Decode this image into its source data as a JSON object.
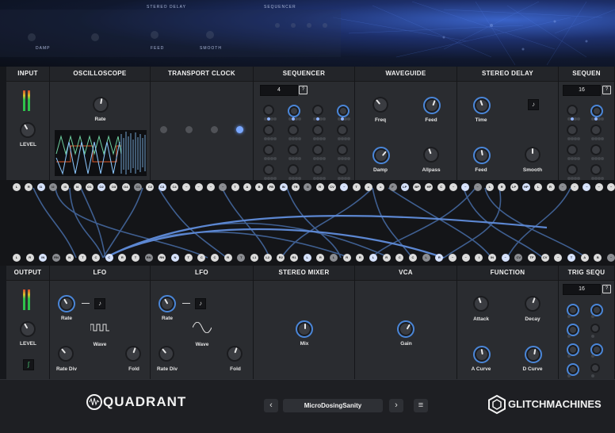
{
  "header": {
    "ghost_labels": [
      "STEREO DELAY",
      "SEQUENCER"
    ],
    "ghost_small": [
      "DAMP",
      "FEED",
      "SMOOTH"
    ]
  },
  "top_modules": {
    "input": {
      "title": "INPUT",
      "level_label": "LEVEL"
    },
    "oscilloscope": {
      "title": "OSCILLOSCOPE",
      "rate_label": "Rate"
    },
    "transport": {
      "title": "TRANSPORT CLOCK",
      "steps": 4,
      "active_step": 4
    },
    "sequencer": {
      "title": "SEQUENCER",
      "steps_value": "4"
    },
    "waveguide": {
      "title": "WAVEGUIDE",
      "knobs": [
        "Freq",
        "Feed",
        "Damp",
        "Allpass"
      ]
    },
    "stereo_delay": {
      "title": "STEREO DELAY",
      "knobs": [
        "Time",
        "Feed",
        "Smooth"
      ]
    },
    "sequencer2": {
      "title": "SEQUEN",
      "steps_value": "16"
    }
  },
  "bottom_modules": {
    "output": {
      "title": "OUTPUT",
      "level_label": "LEVEL"
    },
    "lfo1": {
      "title": "LFO",
      "rate": "Rate",
      "wave": "Wave",
      "rate_div": "Rate Div",
      "fold": "Fold"
    },
    "lfo2": {
      "title": "LFO",
      "rate": "Rate",
      "wave": "Wave",
      "rate_div": "Rate Div",
      "fold": "Fold"
    },
    "stereo_mixer": {
      "title": "STEREO MIXER",
      "mix": "Mix"
    },
    "vca": {
      "title": "VCA",
      "gain": "Gain"
    },
    "function": {
      "title": "FUNCTION",
      "knobs": [
        "Attack",
        "Decay",
        "A Curve",
        "D Curve"
      ]
    },
    "trig_seq": {
      "title": "TRIG SEQU",
      "steps_value": "16"
    }
  },
  "patchbay": {
    "upper_jacks": [
      "L",
      "R",
      "I1",
      "I2",
      "I3",
      "I4",
      "O1",
      "O2",
      "O3",
      "O4",
      "C1",
      "C2",
      "C3",
      "C4",
      "~",
      "~",
      "~",
      "~",
      "T",
      "A",
      "B",
      "FB",
      "IN",
      "TR",
      "G",
      "R",
      "CV",
      "~",
      "T",
      "=",
      "=",
      "F",
      "LP",
      "BP",
      "HP",
      "C",
      "~",
      "~",
      "~",
      "L",
      "R",
      "LP",
      "HP",
      "L",
      "R",
      "~",
      "~",
      "~",
      "~",
      "~"
    ],
    "lower_jacks": [
      "L",
      "R",
      "IN",
      "RN",
      "N",
      "T",
      "C",
      "C",
      "R",
      "T",
      "RN",
      "RN",
      "N",
      "T",
      "C",
      "C",
      "R",
      "T",
      "L1",
      "L2",
      "R2",
      "R1",
      "L",
      "R",
      "L",
      "R",
      "R",
      "L",
      "R",
      "C",
      "C",
      "L",
      "R",
      "~",
      "~",
      "I",
      "IN",
      "~",
      "CV",
      "TF",
      "CV",
      "~",
      "T",
      "A",
      "B",
      "~"
    ]
  },
  "footer": {
    "brand_left": "QUADRANT",
    "preset_name": "MicroDosingSanity",
    "brand_right": "GLITCHMACHINES",
    "prev": "‹",
    "next": "›",
    "menu": "≡"
  },
  "colors": {
    "accent": "#4a86d8",
    "lit": "#7aa8ff"
  }
}
